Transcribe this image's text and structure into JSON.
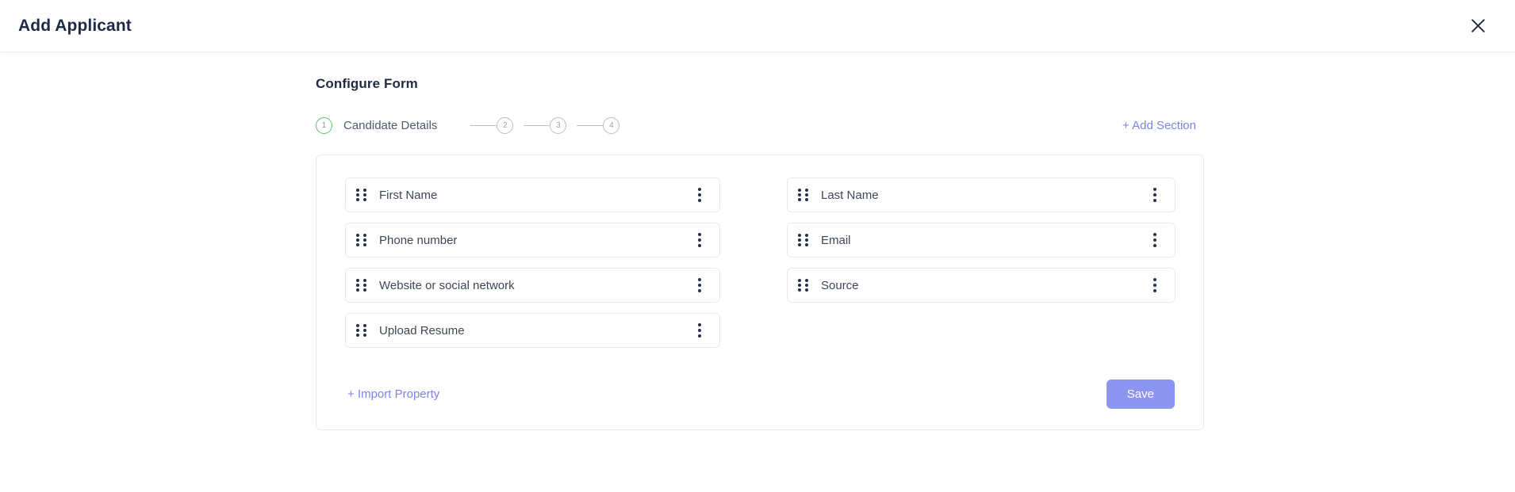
{
  "header": {
    "title": "Add Applicant",
    "close_icon": "close-icon"
  },
  "main": {
    "section_heading": "Configure Form",
    "add_section_label": "+ Add Section"
  },
  "stepper": {
    "steps": [
      {
        "number": "1",
        "label": "Candidate Details",
        "state": "active"
      },
      {
        "number": "2",
        "label": "",
        "state": "inactive"
      },
      {
        "number": "3",
        "label": "",
        "state": "inactive"
      },
      {
        "number": "4",
        "label": "",
        "state": "inactive"
      }
    ],
    "active_color": "#5ec36a",
    "inactive_color": "#b9bec7"
  },
  "form_card": {
    "fields": [
      {
        "label": "First Name",
        "column": "left",
        "drag_icon": "drag-handle-icon",
        "menu_icon": "kebab-menu-icon"
      },
      {
        "label": "Last Name",
        "column": "right",
        "drag_icon": "drag-handle-icon",
        "menu_icon": "kebab-menu-icon"
      },
      {
        "label": "Phone number",
        "column": "left",
        "drag_icon": "drag-handle-icon",
        "menu_icon": "kebab-menu-icon"
      },
      {
        "label": "Email",
        "column": "right",
        "drag_icon": "drag-handle-icon",
        "menu_icon": "kebab-menu-icon"
      },
      {
        "label": "Website or social network",
        "column": "left",
        "drag_icon": "drag-handle-icon",
        "menu_icon": "kebab-menu-icon"
      },
      {
        "label": "Source",
        "column": "right",
        "drag_icon": "drag-handle-icon",
        "menu_icon": "kebab-menu-icon"
      },
      {
        "label": "Upload Resume",
        "column": "left",
        "drag_icon": "drag-handle-icon",
        "menu_icon": "kebab-menu-icon"
      }
    ],
    "import_label": "+ Import Property",
    "save_label": "Save",
    "save_color": "#8d95f3",
    "link_color": "#7c84ec"
  }
}
